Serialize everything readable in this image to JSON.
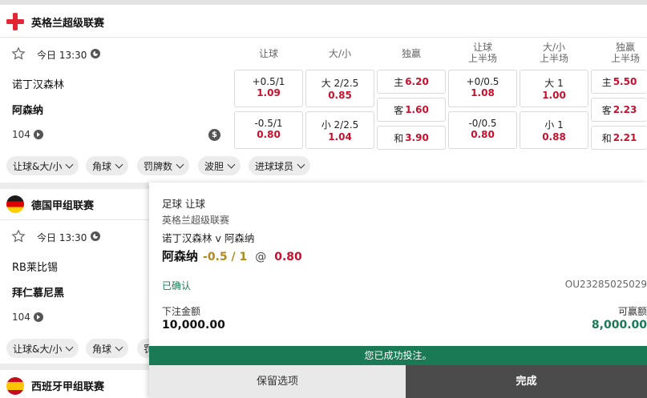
{
  "leagues": [
    {
      "name": "英格兰超级联赛",
      "time": "今日 13:30",
      "home": "诺丁汉森林",
      "away": "阿森纳",
      "count": "104",
      "headers": [
        "让球",
        "大/小",
        "独赢",
        "让球\n上半场",
        "大/小\n上半场",
        "独赢\n上半场"
      ],
      "odds": {
        "hcp_home_l": "+0.5/1",
        "hcp_home_v": "1.09",
        "hcp_away_l": "-0.5/1",
        "hcp_away_v": "0.80",
        "ou_over_l": "大 2/2.5",
        "ou_over_v": "0.85",
        "ou_under_l": "小 2/2.5",
        "ou_under_v": "1.04",
        "mw_home_l": "主",
        "mw_home_v": "6.20",
        "mw_away_l": "客",
        "mw_away_v": "1.60",
        "mw_draw_l": "和",
        "mw_draw_v": "3.90",
        "hhcp_home_l": "+0/0.5",
        "hhcp_home_v": "1.08",
        "hhcp_away_l": "-0/0.5",
        "hhcp_away_v": "0.80",
        "hou_over_l": "大 1",
        "hou_over_v": "1.00",
        "hou_under_l": "小 1",
        "hou_under_v": "0.88",
        "hmw_home_l": "主",
        "hmw_home_v": "5.50",
        "hmw_away_l": "客",
        "hmw_away_v": "2.23",
        "hmw_draw_l": "和",
        "hmw_draw_v": "2.21"
      },
      "pills": [
        "让球&大/小",
        "角球",
        "罚牌数",
        "波胆",
        "进球球员"
      ]
    },
    {
      "name": "德国甲组联赛",
      "time": "今日 13:30",
      "home": "RB莱比锡",
      "away": "拜仁慕尼黑",
      "count": "104",
      "pills": [
        "让球&大/小",
        "角球",
        "罚"
      ]
    },
    {
      "name": "西班牙甲组联赛"
    }
  ],
  "slip": {
    "sport": "足球 让球",
    "competition": "英格兰超级联赛",
    "match": "诺丁汉森林 v 阿森纳",
    "selection": "阿森纳",
    "line": "-0.5 / 1",
    "at": "@",
    "price": "0.80",
    "status": "已确认",
    "ref": "OU23285025029",
    "stake_label": "下注金额",
    "stake": "10,000.00",
    "win_label": "可赢额",
    "win": "8,000.00",
    "banner": "您已成功投注。",
    "keep_label": "保留选项",
    "done_label": "完成"
  },
  "colors": {
    "accent_green": "#1a7a55",
    "odds_red": "#c8102e",
    "line_gold": "#b08a1c"
  }
}
